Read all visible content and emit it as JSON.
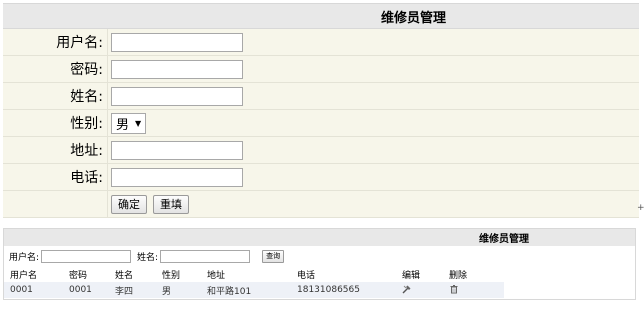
{
  "form": {
    "title": "维修员管理",
    "fields": {
      "username_label": "用户名:",
      "password_label": "密码:",
      "name_label": "姓名:",
      "gender_label": "性别:",
      "gender_value": "男",
      "address_label": "地址:",
      "phone_label": "电话:"
    },
    "confirm_label": "确定",
    "reset_label": "重填",
    "corner_glyph": "+"
  },
  "list": {
    "title": "维修员管理",
    "search": {
      "username_label": "用户名:",
      "name_label": "姓名:",
      "query_label": "查询"
    },
    "columns": [
      "用户名",
      "密码",
      "姓名",
      "性别",
      "地址",
      "电话",
      "编辑",
      "删除"
    ],
    "rows": [
      {
        "username": "0001",
        "password": "0001",
        "name": "李四",
        "gender": "男",
        "address": "和平路101",
        "phone": "18131086565",
        "edit_icon": "tool-edit-icon",
        "delete_icon": "trash-icon"
      }
    ]
  }
}
